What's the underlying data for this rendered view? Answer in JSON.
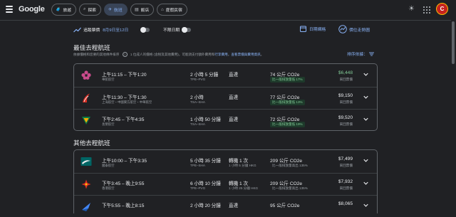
{
  "header": {
    "logo": "Google",
    "tabs": [
      {
        "label": "旅遊",
        "icon": "travel-icon"
      },
      {
        "label": "探索",
        "icon": "explore-icon"
      },
      {
        "label": "航班",
        "icon": "flight-icon",
        "active": true
      },
      {
        "label": "飯店",
        "icon": "hotel-icon"
      },
      {
        "label": "度假民宿",
        "icon": "vacation-rental-icon"
      }
    ],
    "avatar_letter": "C"
  },
  "toolbar": {
    "track_prices": "追蹤票價",
    "date_range": "8月9日至12日",
    "any_dates": "不限日期",
    "date_grid": "日期網格",
    "price_graph": "價位走勢圖"
  },
  "best": {
    "title": "最佳去程航班",
    "note_prefix": "依據價格和您要的其他條件排序",
    "note_mid": "1 位成人的價格 (含稅及其他費用)，可能須支付額外費用和",
    "note_link1": "行李費用",
    "note_sep": "。",
    "note_link2": "查看票價與費用資訊",
    "note_end": "。",
    "sort_label": "排序依據："
  },
  "other": {
    "title": "其他去程航班"
  },
  "best_flights": [
    {
      "logo": "chinaair",
      "time": "上午11:15 – 下午1:20",
      "airline": "華航航空",
      "duration": "2 小時 5 分鐘",
      "route": "TPE–PVG",
      "stops": "直達",
      "stop_detail": "",
      "co2": "74 公斤 CO2e",
      "emission": "比一般排放量低 17%",
      "emission_low": true,
      "price": "$6,448",
      "price_type": "來回票價",
      "price_green": true
    },
    {
      "logo": "shanghai",
      "time": "上午11:30 – 下午1:30",
      "airline": "上海航空・中國東方航空・中華航空",
      "duration": "2 小時",
      "route": "TSA–SHA",
      "stops": "直達",
      "stop_detail": "",
      "co2": "77 公斤 CO2e",
      "emission": "比一般排放量低 13%",
      "emission_low": true,
      "price": "$9,150",
      "price_type": "來回票價",
      "price_green": false
    },
    {
      "logo": "eva",
      "time": "下午2:45 – 下午4:35",
      "airline": "長榮航空",
      "duration": "1 小時 50 分鐘",
      "route": "TSA–SHA",
      "stops": "直達",
      "stop_detail": "",
      "co2": "72 公斤 CO2e",
      "emission": "比一般排放量低 19%",
      "emission_low": true,
      "price": "$9,520",
      "price_type": "來回票價",
      "price_green": false
    }
  ],
  "other_flights": [
    {
      "logo": "cathay",
      "time": "上午10:00 – 下午3:35",
      "airline": "國泰航空",
      "duration": "5 小時 35 分鐘",
      "route": "TPE–SHA",
      "stops": "轉機 1 次",
      "stop_detail": "1 小時 5 分鐘 HKG",
      "co2": "209 公斤 CO2e",
      "emission": "比一般排放量高出 135%",
      "emission_low": false,
      "price": "$7,499",
      "price_type": "來回票價",
      "price_green": false
    },
    {
      "logo": "hkairlines",
      "time": "下午3:45 – 晚上9:55",
      "airline": "香港航空",
      "duration": "6 小時 10 分鐘",
      "route": "TPE–PVG",
      "stops": "轉機 1 次",
      "stop_detail": "1 小時 25 分鐘 HKG",
      "co2": "209 公斤 CO2e",
      "emission": "比一般排放量高出 135%",
      "emission_low": false,
      "price": "$7,932",
      "price_type": "來回票價",
      "price_green": false
    },
    {
      "logo": "blue",
      "time": "下午5:55 – 晚上8:15",
      "airline": "",
      "duration": "2 小時 20 分鐘",
      "route": "",
      "stops": "直達",
      "stop_detail": "",
      "co2": "95 公斤 CO2e",
      "emission": "",
      "emission_low": false,
      "price": "$8,065",
      "price_type": "",
      "price_green": false
    }
  ]
}
